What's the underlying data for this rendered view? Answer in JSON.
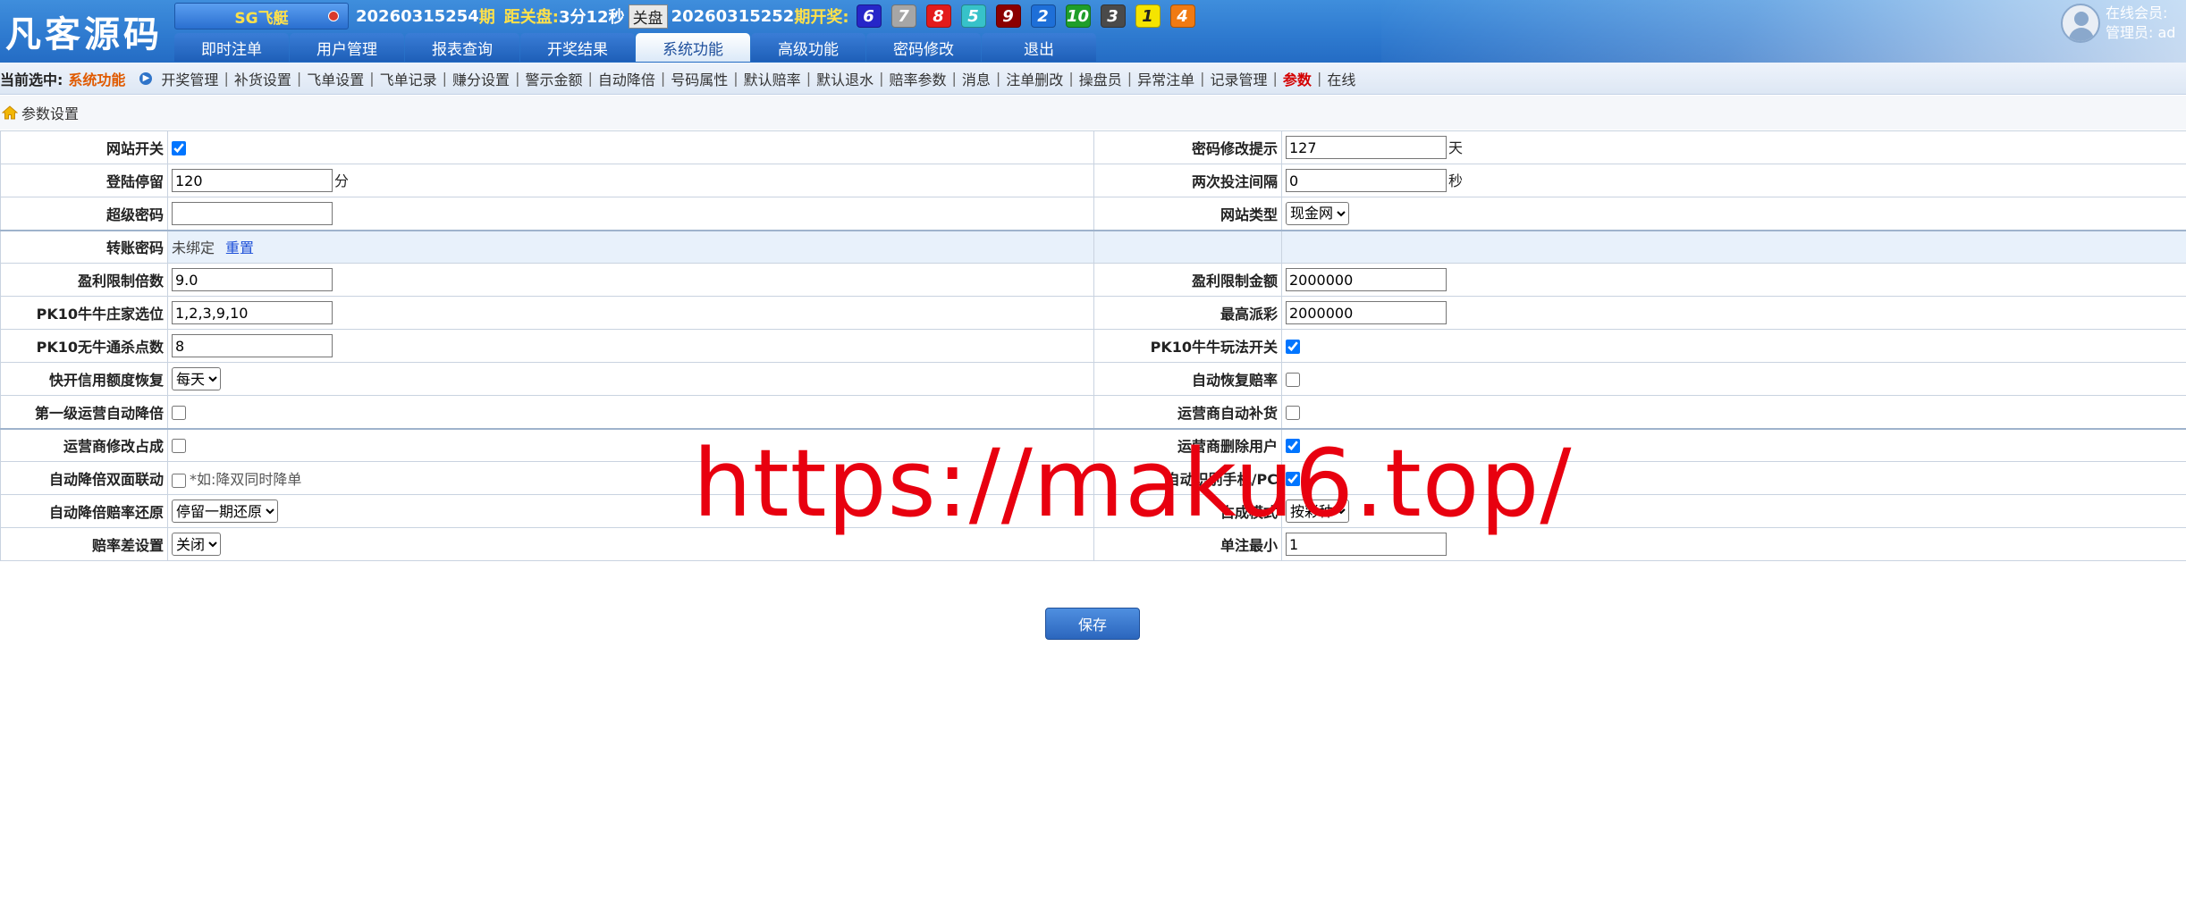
{
  "header": {
    "logo": "凡客源码",
    "game_button": "SG飞艇",
    "period_current": "20260315254",
    "period_suffix": "期",
    "countdown_label": "距关盘:",
    "countdown_value": "3分12秒",
    "closed_badge": "关盘",
    "period_prev": "20260315252",
    "period_prev_suffix": "期开奖:",
    "balls": [
      {
        "n": "6",
        "bg": "#2626c8",
        "fg": "#ffffff"
      },
      {
        "n": "7",
        "bg": "#a6a6a6",
        "fg": "#ffffff"
      },
      {
        "n": "8",
        "bg": "#e31b1b",
        "fg": "#ffffff"
      },
      {
        "n": "5",
        "bg": "#37c2c9",
        "fg": "#ffffff"
      },
      {
        "n": "9",
        "bg": "#8b0000",
        "fg": "#ffffff"
      },
      {
        "n": "2",
        "bg": "#1e6fd8",
        "fg": "#ffffff"
      },
      {
        "n": "10",
        "bg": "#1f9e2a",
        "fg": "#ffffff"
      },
      {
        "n": "3",
        "bg": "#4a4a4a",
        "fg": "#ffffff"
      },
      {
        "n": "1",
        "bg": "#f5e400",
        "fg": "#222222"
      },
      {
        "n": "4",
        "bg": "#f07a12",
        "fg": "#ffffff"
      }
    ],
    "nav_tabs": [
      "即时注单",
      "用户管理",
      "报表查询",
      "开奖结果",
      "系统功能",
      "高级功能",
      "密码修改",
      "退出"
    ],
    "active_tab": 4,
    "online_members": "在线会员:",
    "admin_label": "管理员: ad"
  },
  "subnav": {
    "current_label": "当前选中:",
    "current_value": "系统功能",
    "links": [
      "开奖管理",
      "补货设置",
      "飞单设置",
      "飞单记录",
      "赚分设置",
      "警示金额",
      "自动降倍",
      "号码属性",
      "默认赔率",
      "默认退水",
      "赔率参数",
      "消息",
      "注单删改",
      "操盘员",
      "异常注单",
      "记录管理",
      "参数",
      "在线"
    ],
    "active_link": 16
  },
  "section_title": "参数设置",
  "form": {
    "rows": [
      {
        "l_label": "网站开关",
        "l_type": "checkbox",
        "l_checked": true,
        "r_label": "密码修改提示",
        "r_type": "input",
        "r_value": "127",
        "r_unit": "天"
      },
      {
        "l_label": "登陆停留",
        "l_type": "input",
        "l_value": "120",
        "l_unit": "分",
        "r_label": "两次投注间隔",
        "r_type": "input",
        "r_value": "0",
        "r_unit": "秒"
      },
      {
        "l_label": "超级密码",
        "l_type": "input",
        "l_value": "",
        "r_label": "网站类型",
        "r_type": "select",
        "r_value": "现金网"
      },
      {
        "l_label": "转账密码",
        "l_type": "text",
        "l_value": "未绑定",
        "l_link": "重置",
        "r_label": "",
        "r_type": "empty"
      },
      {
        "l_label": "盈利限制倍数",
        "l_type": "input",
        "l_value": "9.0",
        "r_label": "盈利限制金额",
        "r_type": "input",
        "r_value": "2000000"
      },
      {
        "l_label": "PK10牛牛庄家选位",
        "l_type": "input",
        "l_value": "1,2,3,9,10",
        "r_label": "最高派彩",
        "r_type": "input",
        "r_value": "2000000"
      },
      {
        "l_label": "PK10无牛通杀点数",
        "l_type": "input",
        "l_value": "8",
        "r_label": "PK10牛牛玩法开关",
        "r_type": "checkbox",
        "r_checked": true
      },
      {
        "l_label": "快开信用额度恢复",
        "l_type": "select",
        "l_value": "每天",
        "r_label": "自动恢复赔率",
        "r_type": "checkbox",
        "r_checked": false
      },
      {
        "l_label": "第一级运营自动降倍",
        "l_type": "checkbox",
        "l_checked": false,
        "r_label": "运营商自动补货",
        "r_type": "checkbox",
        "r_checked": false
      },
      {
        "l_label": "运营商修改占成",
        "l_type": "checkbox",
        "l_checked": false,
        "r_label": "运营商删除用户",
        "r_type": "checkbox",
        "r_checked": true
      },
      {
        "l_label": "自动降倍双面联动",
        "l_type": "checkbox",
        "l_checked": false,
        "l_note": "*如:降双同时降单",
        "r_label": "自动识别手机/PC",
        "r_type": "checkbox",
        "r_checked": true
      },
      {
        "l_label": "自动降倍赔率还原",
        "l_type": "select",
        "l_value": "停留一期还原",
        "r_label": "占成模式",
        "r_type": "select",
        "r_value": "按彩种"
      },
      {
        "l_label": "赔率差设置",
        "l_type": "select",
        "l_value": "关闭",
        "r_label": "单注最小",
        "r_type": "input",
        "r_value": "1"
      }
    ]
  },
  "save_button": "保存",
  "watermark": "https://maku6.top/"
}
